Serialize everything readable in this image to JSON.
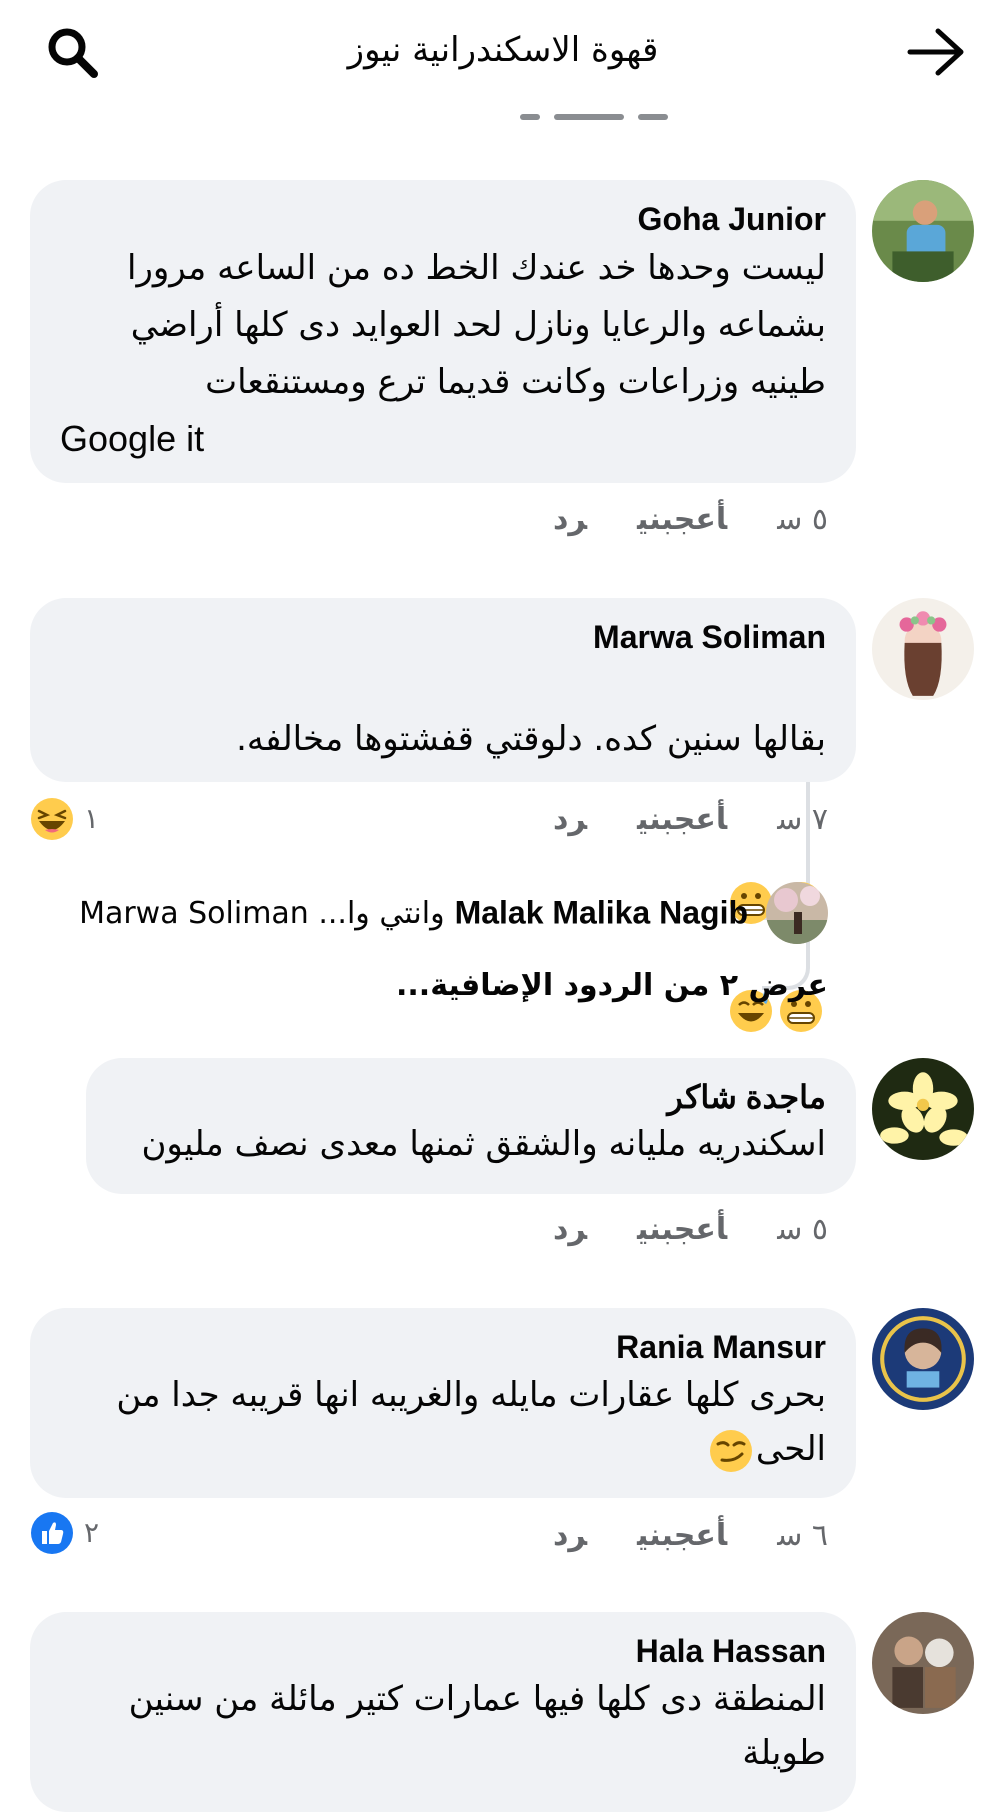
{
  "header": {
    "title": "قهوة الاسكندرانية نيوز",
    "back_icon": "arrow-right-icon",
    "search_icon": "search-icon"
  },
  "comments": [
    {
      "author": "Goha Junior",
      "text": "ليست وحدها خد عندك الخط ده من الساعه مرورا\nبشماعه والرعايا ونازل لحد  العوايد دى كلها أراضي\nطينيه وزراعات وكانت قديما ترع ومستنقعات",
      "text_ltr": "Google it",
      "time": "٥ س",
      "like": "أعجبني",
      "reply": "رد"
    },
    {
      "author": "Marwa Soliman",
      "text": "بقالها سنين كده.  دلوقتي قفشتوها مخالفه.",
      "emojis": [
        "grimacing-emoji",
        "grimacing-emoji",
        "grimacing-emoji",
        "sweat-smile-emoji"
      ],
      "time": "٧ س",
      "like": "أعجبني",
      "reply": "رد",
      "reaction": {
        "icon": "haha-reaction-icon",
        "count": "١"
      }
    },
    {
      "author": "ماجدة شاكر",
      "text": "اسكندريه مليانه والشقق ثمنها معدى نصف مليون",
      "time": "٥ س",
      "like": "أعجبني",
      "reply": "رد"
    },
    {
      "author": "Rania Mansur",
      "text": "بحرى كلها عقارات مايله والغريبه انها قريبه جدا من\nالحى",
      "emojis": [
        "smirk-emoji"
      ],
      "time": "٦ س",
      "like": "أعجبني",
      "reply": "رد",
      "reaction": {
        "icon": "like-reaction-icon",
        "count": "٢"
      }
    },
    {
      "author": "Hala Hassan",
      "text": "المنطقة دى كلها فيها عمارات كتير مائلة من سنين\nطويلة"
    }
  ],
  "reply_preview": {
    "author": "Malak Malika Nagib",
    "snippet": "وانتي وا... Marwa Soliman",
    "more_replies": "عرض ٢ من الردود الإضافية..."
  },
  "colors": {
    "bubble": "#f0f2f5",
    "meta": "#65676b",
    "text": "#050505",
    "like_blue": "#1877f2"
  }
}
